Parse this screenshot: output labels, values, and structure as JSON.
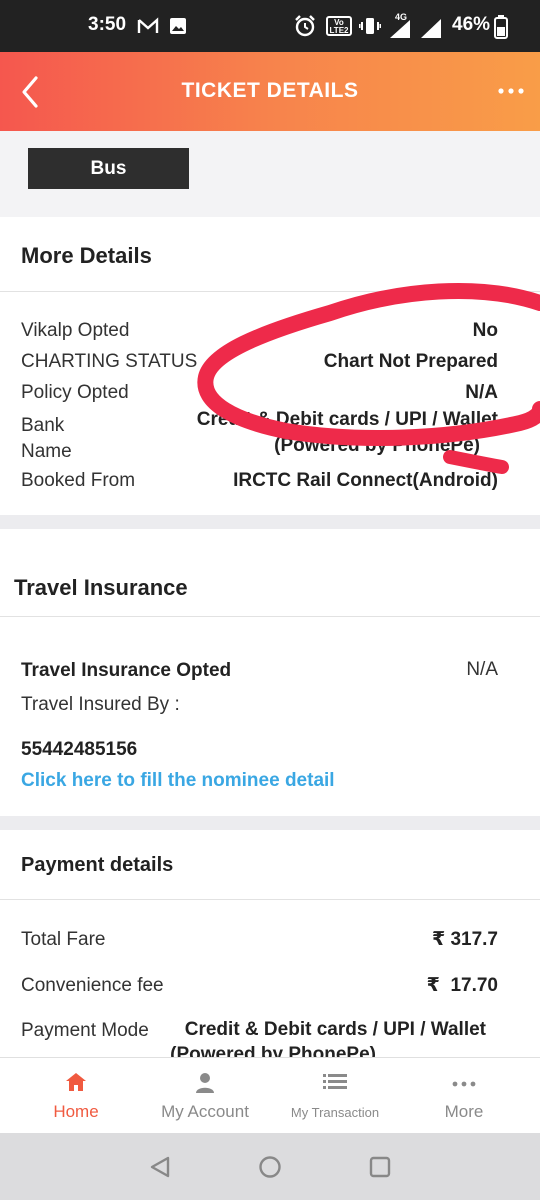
{
  "status_bar": {
    "time": "3:50",
    "battery": "46%",
    "net_label": "4G",
    "volte_label": "LTE2"
  },
  "app_bar": {
    "title": "TICKET DETAILS"
  },
  "mode_button": {
    "label": "Bus"
  },
  "more_details": {
    "heading": "More Details",
    "rows": [
      {
        "label": "Vikalp Opted",
        "value": "No"
      },
      {
        "label": "CHARTING STATUS",
        "value": "Chart Not Prepared"
      },
      {
        "label": "Policy Opted",
        "value": "N/A"
      },
      {
        "label": "Bank Name",
        "value": "Credit & Debit cards / UPI / Wallet",
        "value_line2": "(Powered by PhonePe)"
      },
      {
        "label": "Booked From",
        "value": "IRCTC Rail Connect(Android)"
      }
    ]
  },
  "travel_insurance": {
    "heading": "Travel Insurance",
    "opted_label": "Travel Insurance Opted",
    "opted_value": "N/A",
    "insured_by_label": "Travel Insured By :",
    "policy_number": "55442485156",
    "nominee_link": "Click here to fill the nominee detail"
  },
  "payment": {
    "heading": "Payment details",
    "total_fare_label": "Total Fare",
    "total_fare_value": "₹ 317.7",
    "convenience_label": "Convenience fee",
    "convenience_value": "₹  17.70",
    "mode_label": "Payment Mode",
    "mode_value": "Credit & Debit cards / UPI / Wallet",
    "mode_value_line2": "(Powered by PhonePe)"
  },
  "bottom_nav": [
    {
      "label": "Home",
      "icon": "home-icon",
      "active": true
    },
    {
      "label": "My Account",
      "icon": "person-icon",
      "active": false
    },
    {
      "label": "My Transaction",
      "icon": "list-icon",
      "active": false
    },
    {
      "label": "More",
      "icon": "more-dots-icon",
      "active": false
    }
  ],
  "colors": {
    "accent": "#f5574e",
    "link": "#3aa7e3",
    "annotation": "#ee2a4a",
    "nav_active": "#f05a40"
  }
}
